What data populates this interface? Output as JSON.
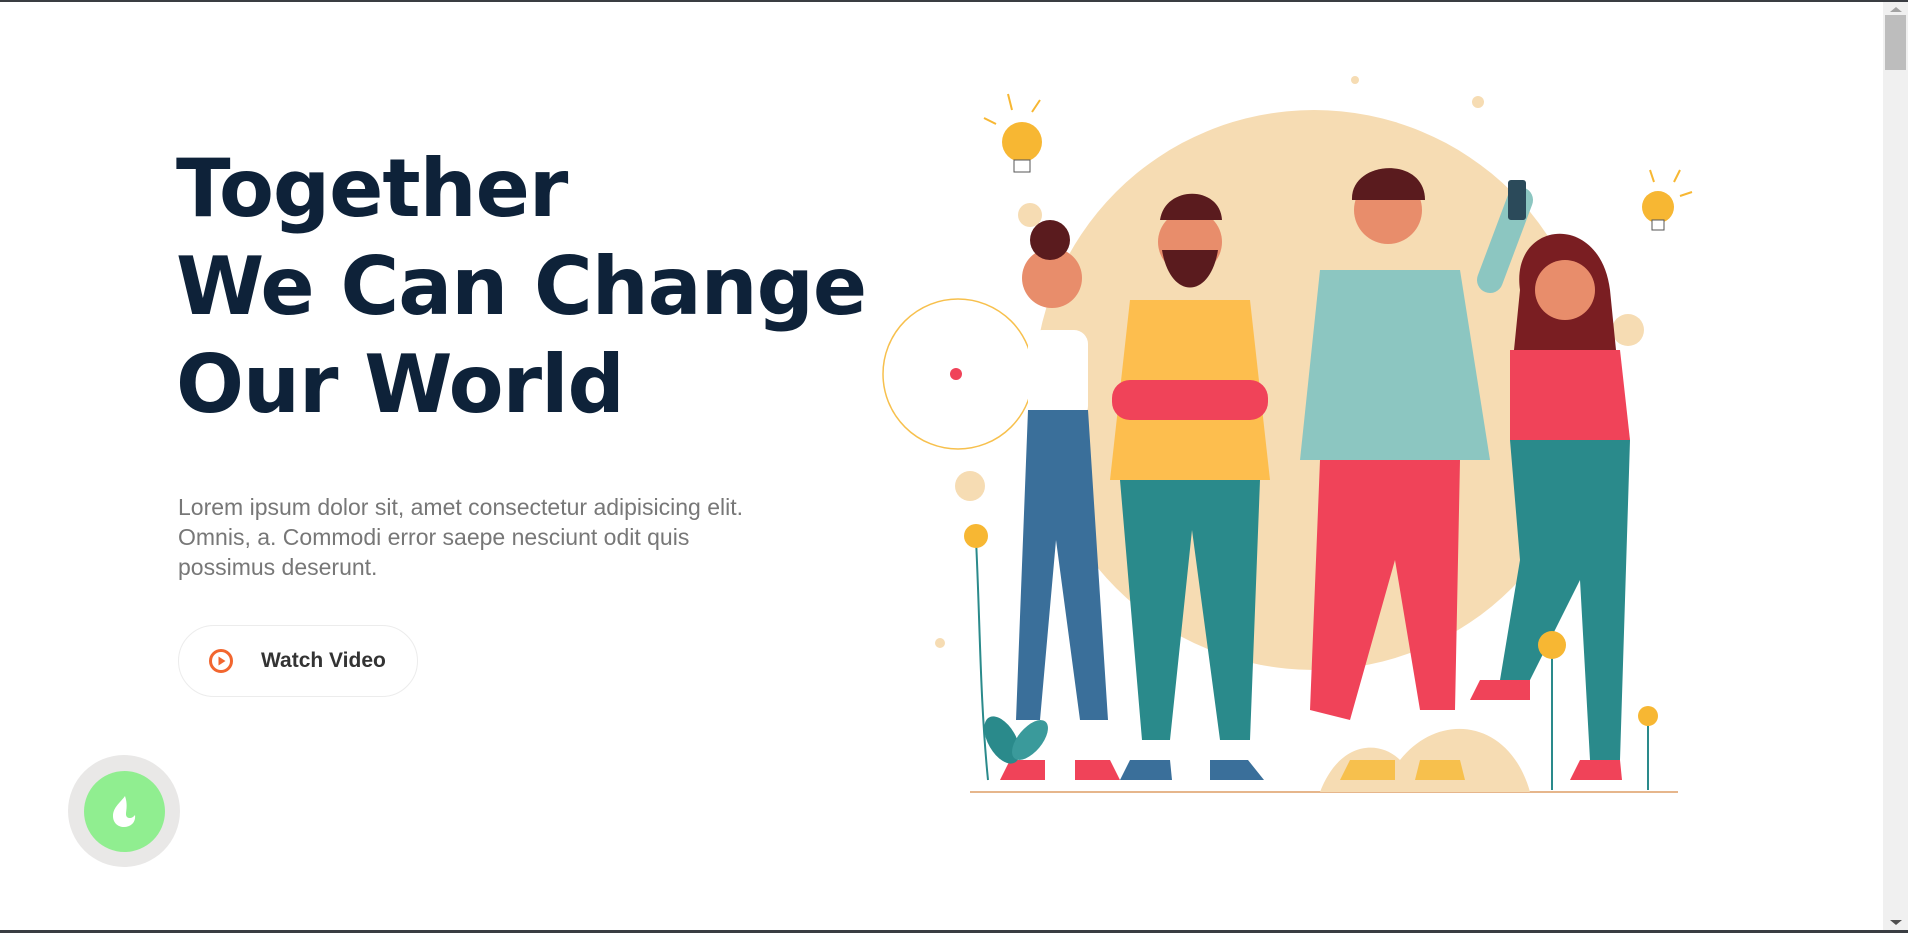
{
  "hero": {
    "title_lines": [
      "Together",
      "We Can Change",
      "Our World"
    ],
    "description": "Lorem ipsum dolor sit, amet consectetur adipisicing elit. Omnis, a. Commodi error saepe nesciunt odit quis possimus deserunt.",
    "watch_video_label": "Watch Video",
    "watch_video_icon": "play-circle-icon"
  },
  "floating_button": {
    "icon": "flame-icon"
  },
  "illustration": {
    "subject": "group-of-friends-illustration"
  },
  "colors": {
    "heading": "#0e2239",
    "text": "#777777",
    "accent": "#f2662f",
    "fab": "#90ee90",
    "blob": "#f6dcb3"
  }
}
